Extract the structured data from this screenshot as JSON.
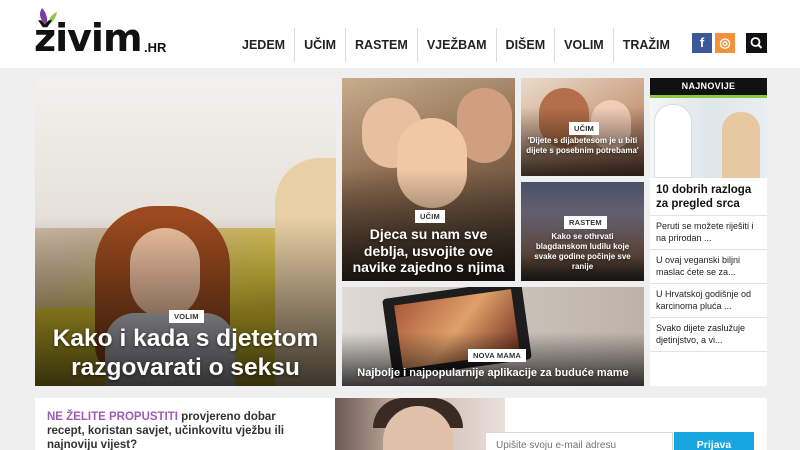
{
  "header": {
    "logo": {
      "word": "živim",
      "tld": ".HR"
    },
    "nav": [
      {
        "label": "JEDEM"
      },
      {
        "label": "UČIM"
      },
      {
        "label": "RASTEM"
      },
      {
        "label": "VJEŽBAM"
      },
      {
        "label": "DIŠEM"
      },
      {
        "label": "VOLIM"
      },
      {
        "label": "TRAŽIM"
      }
    ],
    "social": {
      "facebook": "f",
      "instagram": "◎"
    },
    "icons": {
      "facebook": "facebook-icon",
      "instagram": "instagram-icon",
      "search": "search-icon"
    }
  },
  "articles": {
    "main": {
      "tag": "VOLIM",
      "title": "Kako i kada s djetetom razgovarati o seksu"
    },
    "second": {
      "tag": "UČIM",
      "title": "Djeca su nam sve debljа, usvojite ove navike zajedno s njima"
    },
    "third": {
      "tag": "UČIM",
      "title": "'Dijete s dijabetesom je u biti dijete s posebnim potrebama'"
    },
    "fourth": {
      "tag": "RASTEM",
      "title": "Kako se othrvati blagdanskom ludilu koje svake godine počinje sve ranije"
    },
    "fifth": {
      "tag": "NOVA MAMA",
      "title": "Najbolje i najpopularnije aplikacije za buduće mame"
    }
  },
  "latest": {
    "heading": "NAJNOVIJE",
    "accent": "#8dc63f",
    "featured": "10 dobrih razloga za pregled srca",
    "items": [
      "Peruti se možete riješiti i na prirodan ...",
      "U ovaj veganski biljni maslac ćete se za...",
      "U Hrvatskoj godišnje od karcinoma pluća ...",
      "Svako dijete zaslužuje djetinjstvo, a vi..."
    ]
  },
  "newsletter": {
    "highlight": "NE ŽELITE PROPUSTITI",
    "text": " provjereno dobar recept, koristan savjet, učinkovitu vježbu ili najnoviju vijest?",
    "placeholder": "Upišite svoju e-mail adresu",
    "button": "Prijava",
    "button_color": "#17a7de"
  }
}
